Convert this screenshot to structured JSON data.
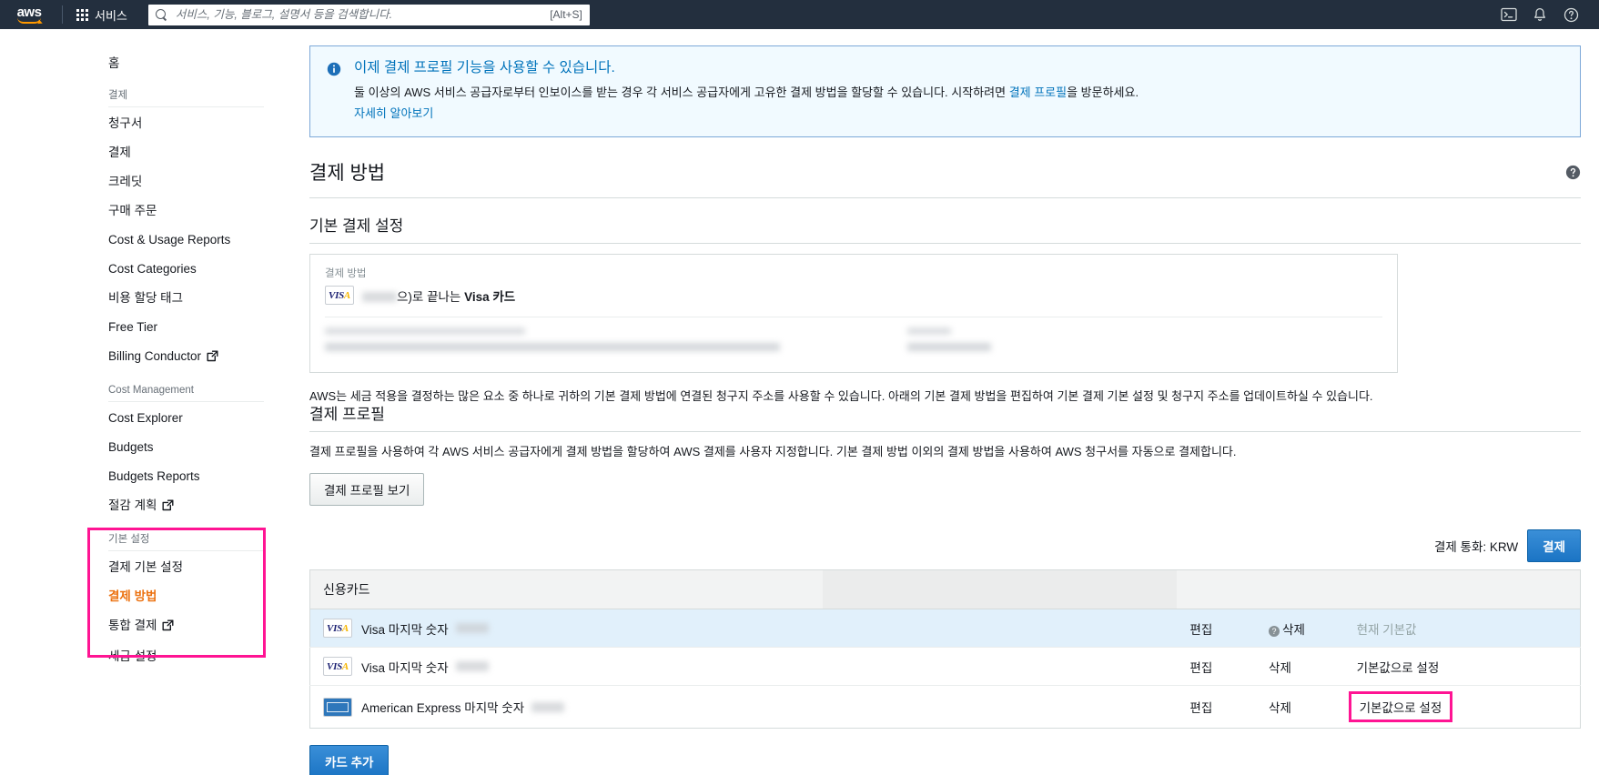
{
  "topnav": {
    "logo_alt": "aws",
    "services_label": "서비스",
    "search_placeholder": "서비스, 기능, 블로그, 설명서 등을 검색합니다.",
    "search_value": "",
    "search_shortcut": "[Alt+S]",
    "icons": [
      "cloudshell-icon",
      "bell-icon",
      "help-icon"
    ]
  },
  "sidebar": {
    "home": "홈",
    "groups": [
      {
        "label": "결제",
        "items": [
          {
            "label": "청구서",
            "external": false
          },
          {
            "label": "결제",
            "external": false
          },
          {
            "label": "크레딧",
            "external": false
          },
          {
            "label": "구매 주문",
            "external": false
          },
          {
            "label": "Cost & Usage Reports",
            "external": false
          },
          {
            "label": "Cost Categories",
            "external": false
          },
          {
            "label": "비용 할당 태그",
            "external": false
          },
          {
            "label": "Free Tier",
            "external": false
          },
          {
            "label": "Billing Conductor",
            "external": true
          }
        ]
      },
      {
        "label": "Cost Management",
        "items": [
          {
            "label": "Cost Explorer",
            "external": false
          },
          {
            "label": "Budgets",
            "external": false
          },
          {
            "label": "Budgets Reports",
            "external": false
          },
          {
            "label": "절감 계획",
            "external": true
          }
        ]
      },
      {
        "label": "기본 설정",
        "items": [
          {
            "label": "결제 기본 설정",
            "external": false
          },
          {
            "label": "결제 방법",
            "external": false,
            "active": true
          },
          {
            "label": "통합 결제",
            "external": true
          },
          {
            "label": "세금 설정",
            "external": false
          }
        ]
      }
    ]
  },
  "banner": {
    "icon": "info-icon",
    "title": "이제 결제 프로필 기능을 사용할 수 있습니다.",
    "body_before": "둘 이상의 AWS 서비스 공급자로부터 인보이스를 받는 경우 각 서비스 공급자에게 고유한 결제 방법을 할당할 수 있습니다. 시작하려면 ",
    "body_link": "결제 프로필",
    "body_after": "을 방문하세요.",
    "learn_more": "자세히 알아보기"
  },
  "page": {
    "title": "결제 방법",
    "help_icon": "help-circle-icon"
  },
  "default_payment": {
    "section_title": "기본 결제 설정",
    "field_label": "결제 방법",
    "card_brand": "visa-icon",
    "card_masked": "••••",
    "card_text_after": "으)로 끝나는 ",
    "card_text_bold": "Visa 카드",
    "address_label_blurred": "redacted-billing-address-label",
    "address_value_blurred": "redacted-billing-address",
    "phone_label_blurred": "redacted-phone-label",
    "phone_value_blurred": "redacted-phone-number"
  },
  "tax_note": "AWS는 세금 적용을 결정하는 많은 요소 중 하나로 귀하의 기본 결제 방법에 연결된 청구지 주소를 사용할 수 있습니다. 아래의 기본 결제 방법을 편집하여 기본 결제 기본 설정 및 청구지 주소를 업데이트하실 수 있습니다.",
  "billing_profile": {
    "section_title": "결제 프로필",
    "description": "결제 프로필을 사용하여 각 AWS 서비스 공급자에게 결제 방법을 할당하여 AWS 결제를 사용자 지정합니다. 기본 결제 방법 이외의 결제 방법을 사용하여 AWS 청구서를 자동으로 결제합니다.",
    "button": "결제 프로필 보기"
  },
  "currency_bar": {
    "label": "결제 통화: KRW",
    "pay_button": "결제"
  },
  "table": {
    "headers": {
      "card": "신용카드",
      "expiry_blurred": "redacted-expiry-header",
      "status_blurred": "redacted-status-header",
      "actions": ""
    },
    "rows": [
      {
        "brand": "visa-icon",
        "name": "Visa 마지막 숫자",
        "number_blurred": "1337",
        "expiry_blurred": "redacted-expiry",
        "status_blurred": "redacted-status",
        "edit": "편집",
        "delete": "삭제",
        "delete_disabled": true,
        "delete_help_icon": "question-mark-icon",
        "default_text": "현재 기본값",
        "is_default": true,
        "highlighted": false
      },
      {
        "brand": "visa-icon",
        "name": "Visa 마지막 숫자",
        "number_blurred": "2219",
        "expiry_blurred": "redacted-expiry",
        "status_blurred": "redacted-status",
        "edit": "편집",
        "delete": "삭제",
        "delete_disabled": false,
        "default_text": "기본값으로 설정",
        "is_default": false,
        "highlighted": false
      },
      {
        "brand": "amex-icon",
        "name": "American Express 마지막 숫자",
        "number_blurred": "1004",
        "expiry_blurred": "redacted-expiry",
        "status_blurred": "redacted-status",
        "edit": "편집",
        "delete": "삭제",
        "delete_disabled": false,
        "default_text": "기본값으로 설정",
        "is_default": false,
        "highlighted": true
      }
    ]
  },
  "add_card_button": "카드 추가",
  "colors": {
    "aws_navy": "#232f3e",
    "aws_orange": "#ec7211",
    "link_blue": "#0073bb",
    "highlight_magenta": "#ff1493",
    "banner_bg": "#f1faff",
    "row_selected": "#e1f0fb"
  }
}
